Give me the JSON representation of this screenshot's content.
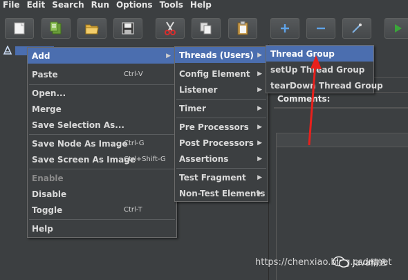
{
  "menubar": {
    "items": [
      {
        "label": "File"
      },
      {
        "label": "Edit"
      },
      {
        "label": "Search"
      },
      {
        "label": "Run"
      },
      {
        "label": "Options"
      },
      {
        "label": "Tools"
      },
      {
        "label": "Help"
      }
    ]
  },
  "toolbar": {
    "buttons": [
      "new-icon",
      "templates-icon",
      "open-icon",
      "save-icon",
      "cut-icon",
      "copy-icon",
      "paste-icon",
      "expand-icon",
      "collapse-icon",
      "toggle-icon",
      "start-icon"
    ]
  },
  "tree": {
    "node_icon": "test-plan-icon"
  },
  "context_menu": {
    "items": [
      {
        "label": "Add",
        "arrow": "▶"
      },
      {
        "label": "Paste",
        "shortcut": "Ctrl-V"
      },
      {
        "label": "Open..."
      },
      {
        "label": "Merge"
      },
      {
        "label": "Save Selection As..."
      },
      {
        "label": "Save Node As Image",
        "shortcut": "Ctrl-G"
      },
      {
        "label": "Save Screen As Image",
        "shortcut": "Ctrl+Shift-G"
      },
      {
        "label": "Enable"
      },
      {
        "label": "Disable"
      },
      {
        "label": "Toggle",
        "shortcut": "Ctrl-T"
      },
      {
        "label": "Help"
      }
    ]
  },
  "add_submenu": {
    "items": [
      {
        "label": "Threads (Users)",
        "arrow": "▶"
      },
      {
        "label": "Config Element",
        "arrow": "▶"
      },
      {
        "label": "Listener",
        "arrow": "▶"
      },
      {
        "label": "Timer",
        "arrow": "▶"
      },
      {
        "label": "Pre Processors",
        "arrow": "▶"
      },
      {
        "label": "Post Processors",
        "arrow": "▶"
      },
      {
        "label": "Assertions",
        "arrow": "▶"
      },
      {
        "label": "Test Fragment",
        "arrow": "▶"
      },
      {
        "label": "Non-Test Elements",
        "arrow": "▶"
      }
    ]
  },
  "threads_submenu": {
    "items": [
      {
        "label": "Thread Group"
      },
      {
        "label": "setUp Thread Group"
      },
      {
        "label": "tearDown Thread Group"
      }
    ]
  },
  "right_panel": {
    "comments_label": "Comments:"
  },
  "annotation": {
    "arrow_color": "#e8201c"
  },
  "watermark": {
    "url": "https://chenxiao.blog.csdn.net",
    "brand": "Java精选"
  },
  "colors": {
    "background": "#3c3f41",
    "highlight": "#4b6eaf",
    "text": "#d9d9d9"
  }
}
